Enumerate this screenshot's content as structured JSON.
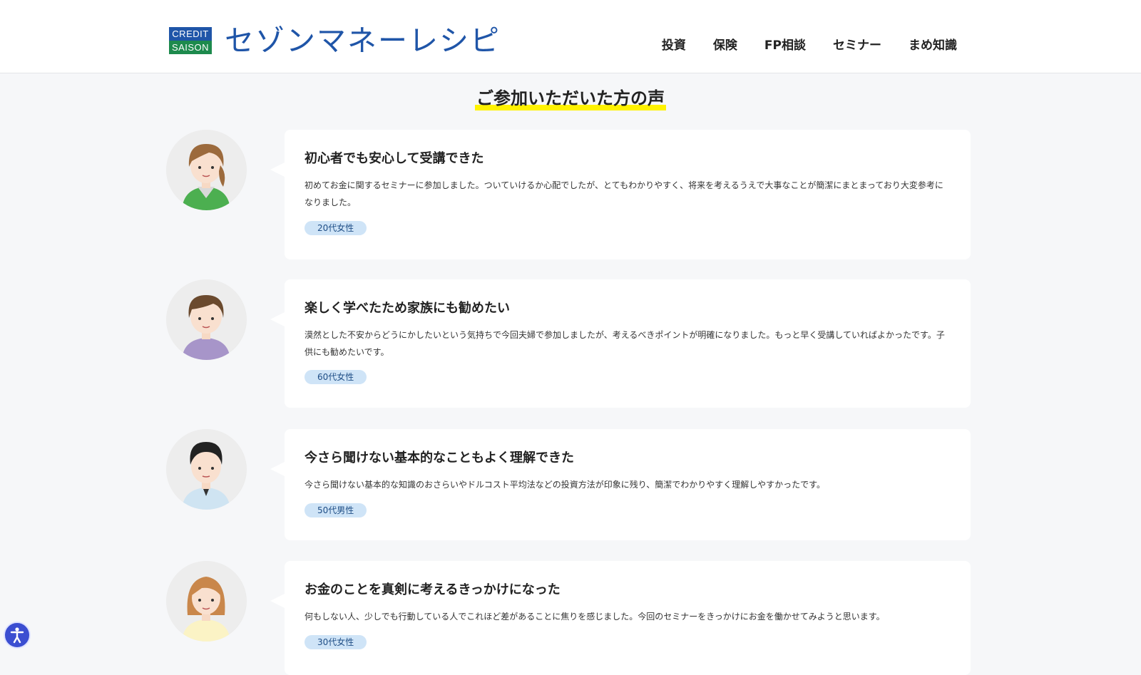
{
  "header": {
    "logo": {
      "badge_top": "CREDIT",
      "badge_bottom": "SAISON",
      "wordmark": "セゾンマネーレシピ"
    },
    "nav": [
      {
        "label": "投資"
      },
      {
        "label": "保険"
      },
      {
        "label": "FP相談"
      },
      {
        "label": "セミナー"
      },
      {
        "label": "まめ知識"
      }
    ]
  },
  "section": {
    "title": "ご参加いただいた方の声"
  },
  "testimonials": [
    {
      "title": "初心者でも安心して受講できた",
      "body": "初めてお金に関するセミナーに参加しました。ついていけるか心配でしたが、とてもわかりやすく、将来を考えるうえで大事なことが簡潔にまとまっており大変参考になりました。",
      "tag": "20代女性",
      "avatar": "young-woman-avatar-icon"
    },
    {
      "title": "楽しく学べたため家族にも勧めたい",
      "body": "漠然とした不安からどうにかしたいという気持ちで今回夫婦で参加しましたが、考えるべきポイントが明確になりました。もっと早く受講していればよかったです。子供にも勧めたいです。",
      "tag": "60代女性",
      "avatar": "older-woman-avatar-icon"
    },
    {
      "title": "今さら聞けない基本的なこともよく理解できた",
      "body": "今さら聞けない基本的な知識のおさらいやドルコスト平均法などの投資方法が印象に残り、簡潔でわかりやすく理解しやすかったです。",
      "tag": "50代男性",
      "avatar": "man-avatar-icon"
    },
    {
      "title": "お金のことを真剣に考えるきっかけになった",
      "body": "何もしない人、少しでも行動している人でこれほど差があることに焦りを感じました。今回のセミナーをきっかけにお金を働かせてみようと思います。",
      "tag": "30代女性",
      "avatar": "woman-avatar-icon"
    }
  ],
  "accessibility": {
    "icon": "accessibility-icon"
  }
}
